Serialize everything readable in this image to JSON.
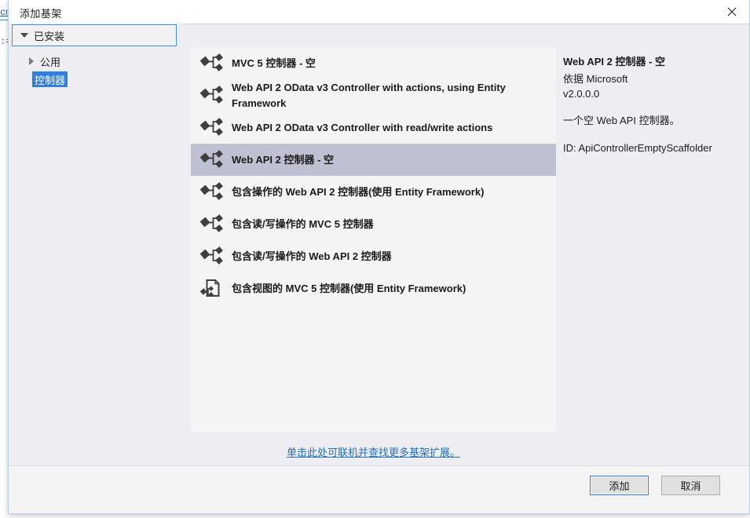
{
  "background": {
    "code_fragments": [
      {
        "text": "cm",
        "kind": "link"
      },
      {
        "text": ":=",
        "kind": "attr"
      }
    ]
  },
  "dialog": {
    "title": "添加基架",
    "close_icon": "close-icon"
  },
  "tree": {
    "installed": {
      "label": "已安装",
      "expanded": true,
      "chevron": "chevron-down-icon"
    },
    "items": [
      {
        "label": "公用",
        "expanded": false,
        "selected": false,
        "chevron": "chevron-right-icon"
      },
      {
        "label": "控制器",
        "expanded": false,
        "selected": true,
        "chevron": "none"
      }
    ]
  },
  "list": {
    "items": [
      {
        "label": "MVC 5 控制器 - 空",
        "icon": "scaffold-icon",
        "selected": false
      },
      {
        "label": "Web API 2 OData v3 Controller with actions, using Entity Framework",
        "icon": "scaffold-icon",
        "selected": false
      },
      {
        "label": "Web API 2 OData v3 Controller with read/write actions",
        "icon": "scaffold-icon",
        "selected": false
      },
      {
        "label": "Web API 2 控制器 - 空",
        "icon": "scaffold-icon",
        "selected": true
      },
      {
        "label": "包含操作的 Web API 2 控制器(使用 Entity Framework)",
        "icon": "scaffold-icon",
        "selected": false
      },
      {
        "label": "包含读/写操作的 MVC 5 控制器",
        "icon": "scaffold-icon",
        "selected": false
      },
      {
        "label": "包含读/写操作的 Web API 2 控制器",
        "icon": "scaffold-icon",
        "selected": false
      },
      {
        "label": "包含视图的 MVC 5 控制器(使用 Entity Framework)",
        "icon": "scaffold-document-icon",
        "selected": false
      }
    ]
  },
  "details": {
    "title": "Web API 2 控制器 - 空",
    "author": "依据 Microsoft",
    "version": "v2.0.0.0",
    "description": "一个空 Web API 控制器。",
    "id": "ID: ApiControllerEmptyScaffolder"
  },
  "online_link": {
    "label": "单击此处可联机并查找更多基架扩展。"
  },
  "footer": {
    "add_label": "添加",
    "cancel_label": "取消"
  },
  "colors": {
    "accent": "#2f7fe0",
    "selection_row": "#bfc0d1",
    "tree_selection": "#2f7fe0",
    "link": "#2072c4",
    "dialog_bg": "#eeedf2",
    "list_bg": "#f4f4f4",
    "footer_bg": "#f4f4f4"
  }
}
